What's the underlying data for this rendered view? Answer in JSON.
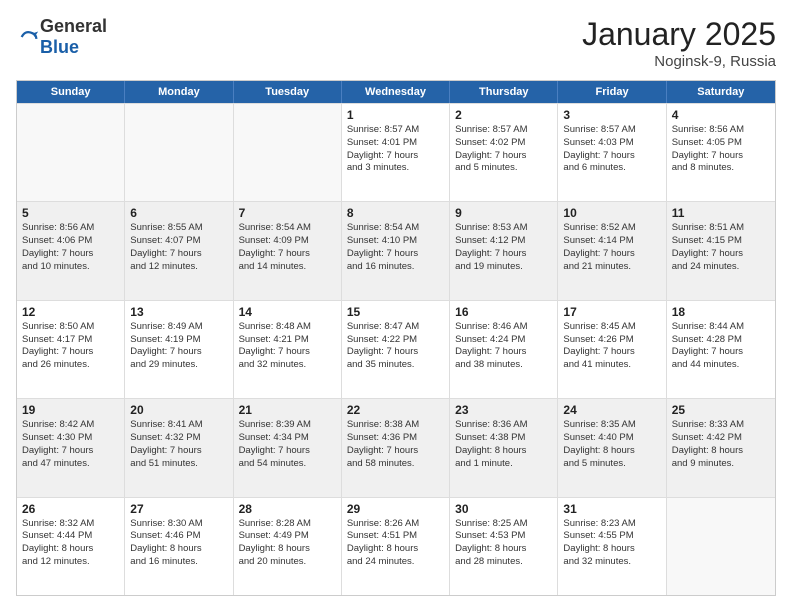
{
  "logo": {
    "general": "General",
    "blue": "Blue"
  },
  "header": {
    "month": "January 2025",
    "location": "Noginsk-9, Russia"
  },
  "weekdays": [
    "Sunday",
    "Monday",
    "Tuesday",
    "Wednesday",
    "Thursday",
    "Friday",
    "Saturday"
  ],
  "rows": [
    [
      {
        "day": "",
        "lines": [],
        "empty": true
      },
      {
        "day": "",
        "lines": [],
        "empty": true
      },
      {
        "day": "",
        "lines": [],
        "empty": true
      },
      {
        "day": "1",
        "lines": [
          "Sunrise: 8:57 AM",
          "Sunset: 4:01 PM",
          "Daylight: 7 hours",
          "and 3 minutes."
        ],
        "empty": false
      },
      {
        "day": "2",
        "lines": [
          "Sunrise: 8:57 AM",
          "Sunset: 4:02 PM",
          "Daylight: 7 hours",
          "and 5 minutes."
        ],
        "empty": false
      },
      {
        "day": "3",
        "lines": [
          "Sunrise: 8:57 AM",
          "Sunset: 4:03 PM",
          "Daylight: 7 hours",
          "and 6 minutes."
        ],
        "empty": false
      },
      {
        "day": "4",
        "lines": [
          "Sunrise: 8:56 AM",
          "Sunset: 4:05 PM",
          "Daylight: 7 hours",
          "and 8 minutes."
        ],
        "empty": false
      }
    ],
    [
      {
        "day": "5",
        "lines": [
          "Sunrise: 8:56 AM",
          "Sunset: 4:06 PM",
          "Daylight: 7 hours",
          "and 10 minutes."
        ],
        "empty": false,
        "shaded": true
      },
      {
        "day": "6",
        "lines": [
          "Sunrise: 8:55 AM",
          "Sunset: 4:07 PM",
          "Daylight: 7 hours",
          "and 12 minutes."
        ],
        "empty": false,
        "shaded": true
      },
      {
        "day": "7",
        "lines": [
          "Sunrise: 8:54 AM",
          "Sunset: 4:09 PM",
          "Daylight: 7 hours",
          "and 14 minutes."
        ],
        "empty": false,
        "shaded": true
      },
      {
        "day": "8",
        "lines": [
          "Sunrise: 8:54 AM",
          "Sunset: 4:10 PM",
          "Daylight: 7 hours",
          "and 16 minutes."
        ],
        "empty": false,
        "shaded": true
      },
      {
        "day": "9",
        "lines": [
          "Sunrise: 8:53 AM",
          "Sunset: 4:12 PM",
          "Daylight: 7 hours",
          "and 19 minutes."
        ],
        "empty": false,
        "shaded": true
      },
      {
        "day": "10",
        "lines": [
          "Sunrise: 8:52 AM",
          "Sunset: 4:14 PM",
          "Daylight: 7 hours",
          "and 21 minutes."
        ],
        "empty": false,
        "shaded": true
      },
      {
        "day": "11",
        "lines": [
          "Sunrise: 8:51 AM",
          "Sunset: 4:15 PM",
          "Daylight: 7 hours",
          "and 24 minutes."
        ],
        "empty": false,
        "shaded": true
      }
    ],
    [
      {
        "day": "12",
        "lines": [
          "Sunrise: 8:50 AM",
          "Sunset: 4:17 PM",
          "Daylight: 7 hours",
          "and 26 minutes."
        ],
        "empty": false
      },
      {
        "day": "13",
        "lines": [
          "Sunrise: 8:49 AM",
          "Sunset: 4:19 PM",
          "Daylight: 7 hours",
          "and 29 minutes."
        ],
        "empty": false
      },
      {
        "day": "14",
        "lines": [
          "Sunrise: 8:48 AM",
          "Sunset: 4:21 PM",
          "Daylight: 7 hours",
          "and 32 minutes."
        ],
        "empty": false
      },
      {
        "day": "15",
        "lines": [
          "Sunrise: 8:47 AM",
          "Sunset: 4:22 PM",
          "Daylight: 7 hours",
          "and 35 minutes."
        ],
        "empty": false
      },
      {
        "day": "16",
        "lines": [
          "Sunrise: 8:46 AM",
          "Sunset: 4:24 PM",
          "Daylight: 7 hours",
          "and 38 minutes."
        ],
        "empty": false
      },
      {
        "day": "17",
        "lines": [
          "Sunrise: 8:45 AM",
          "Sunset: 4:26 PM",
          "Daylight: 7 hours",
          "and 41 minutes."
        ],
        "empty": false
      },
      {
        "day": "18",
        "lines": [
          "Sunrise: 8:44 AM",
          "Sunset: 4:28 PM",
          "Daylight: 7 hours",
          "and 44 minutes."
        ],
        "empty": false
      }
    ],
    [
      {
        "day": "19",
        "lines": [
          "Sunrise: 8:42 AM",
          "Sunset: 4:30 PM",
          "Daylight: 7 hours",
          "and 47 minutes."
        ],
        "empty": false,
        "shaded": true
      },
      {
        "day": "20",
        "lines": [
          "Sunrise: 8:41 AM",
          "Sunset: 4:32 PM",
          "Daylight: 7 hours",
          "and 51 minutes."
        ],
        "empty": false,
        "shaded": true
      },
      {
        "day": "21",
        "lines": [
          "Sunrise: 8:39 AM",
          "Sunset: 4:34 PM",
          "Daylight: 7 hours",
          "and 54 minutes."
        ],
        "empty": false,
        "shaded": true
      },
      {
        "day": "22",
        "lines": [
          "Sunrise: 8:38 AM",
          "Sunset: 4:36 PM",
          "Daylight: 7 hours",
          "and 58 minutes."
        ],
        "empty": false,
        "shaded": true
      },
      {
        "day": "23",
        "lines": [
          "Sunrise: 8:36 AM",
          "Sunset: 4:38 PM",
          "Daylight: 8 hours",
          "and 1 minute."
        ],
        "empty": false,
        "shaded": true
      },
      {
        "day": "24",
        "lines": [
          "Sunrise: 8:35 AM",
          "Sunset: 4:40 PM",
          "Daylight: 8 hours",
          "and 5 minutes."
        ],
        "empty": false,
        "shaded": true
      },
      {
        "day": "25",
        "lines": [
          "Sunrise: 8:33 AM",
          "Sunset: 4:42 PM",
          "Daylight: 8 hours",
          "and 9 minutes."
        ],
        "empty": false,
        "shaded": true
      }
    ],
    [
      {
        "day": "26",
        "lines": [
          "Sunrise: 8:32 AM",
          "Sunset: 4:44 PM",
          "Daylight: 8 hours",
          "and 12 minutes."
        ],
        "empty": false
      },
      {
        "day": "27",
        "lines": [
          "Sunrise: 8:30 AM",
          "Sunset: 4:46 PM",
          "Daylight: 8 hours",
          "and 16 minutes."
        ],
        "empty": false
      },
      {
        "day": "28",
        "lines": [
          "Sunrise: 8:28 AM",
          "Sunset: 4:49 PM",
          "Daylight: 8 hours",
          "and 20 minutes."
        ],
        "empty": false
      },
      {
        "day": "29",
        "lines": [
          "Sunrise: 8:26 AM",
          "Sunset: 4:51 PM",
          "Daylight: 8 hours",
          "and 24 minutes."
        ],
        "empty": false
      },
      {
        "day": "30",
        "lines": [
          "Sunrise: 8:25 AM",
          "Sunset: 4:53 PM",
          "Daylight: 8 hours",
          "and 28 minutes."
        ],
        "empty": false
      },
      {
        "day": "31",
        "lines": [
          "Sunrise: 8:23 AM",
          "Sunset: 4:55 PM",
          "Daylight: 8 hours",
          "and 32 minutes."
        ],
        "empty": false
      },
      {
        "day": "",
        "lines": [],
        "empty": true
      }
    ]
  ]
}
